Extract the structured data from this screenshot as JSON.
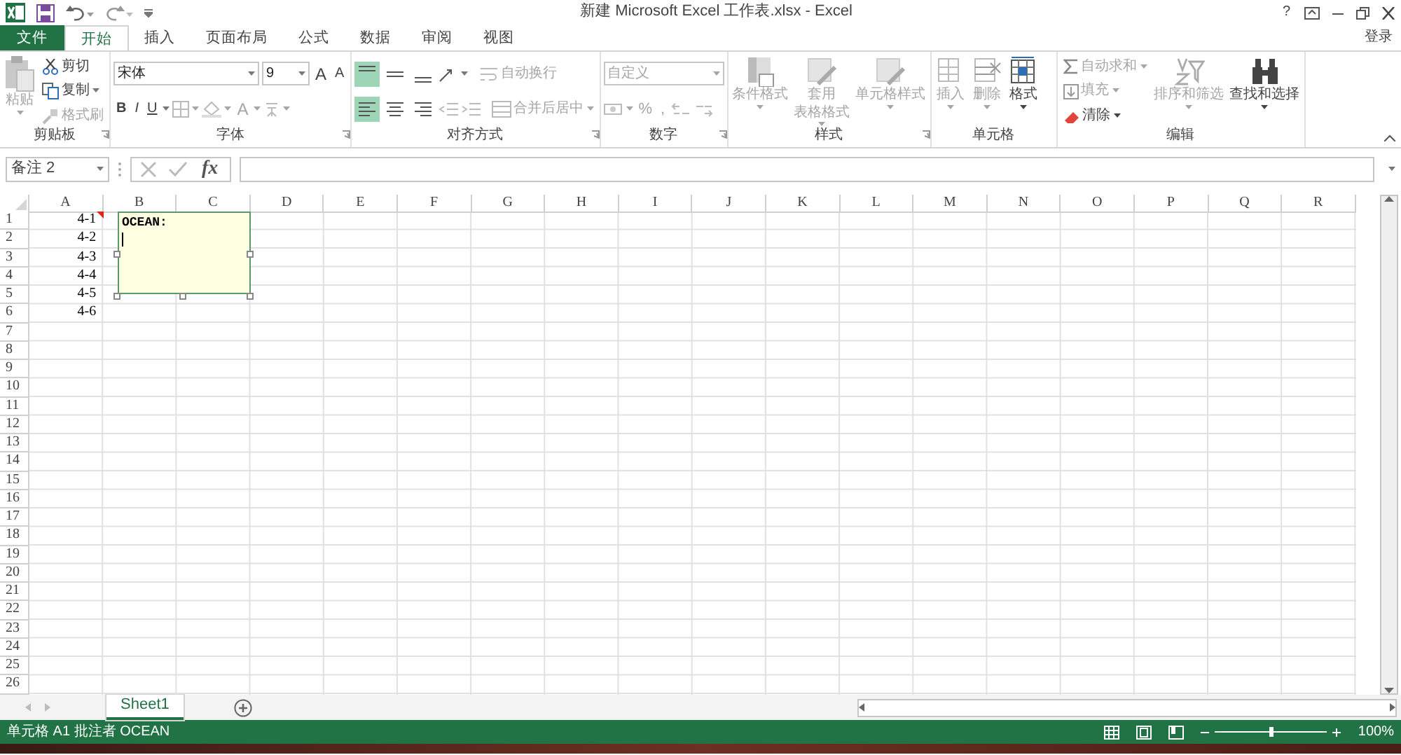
{
  "window": {
    "title": "新建 Microsoft Excel 工作表.xlsx - Excel",
    "help": "?",
    "sign_in": "登录"
  },
  "ribbon_tabs": [
    {
      "label": "文件",
      "kind": "file",
      "selected": false
    },
    {
      "label": "开始",
      "kind": "tab",
      "selected": true
    },
    {
      "label": "插入",
      "kind": "tab",
      "selected": false
    },
    {
      "label": "页面布局",
      "kind": "tab",
      "selected": false
    },
    {
      "label": "公式",
      "kind": "tab",
      "selected": false
    },
    {
      "label": "数据",
      "kind": "tab",
      "selected": false
    },
    {
      "label": "审阅",
      "kind": "tab",
      "selected": false
    },
    {
      "label": "视图",
      "kind": "tab",
      "selected": false
    }
  ],
  "clipboard": {
    "label": "剪贴板",
    "paste": "粘贴",
    "cut": "剪切",
    "copy": "复制",
    "format_painter": "格式刷"
  },
  "font": {
    "label": "字体",
    "font_name": "宋体",
    "font_size": "9",
    "grow": "A",
    "shrink": "A",
    "bold": "B",
    "italic": "I",
    "underline": "U",
    "font_color": "A"
  },
  "alignment": {
    "label": "对齐方式",
    "vertical": [
      {
        "selected": true
      },
      {
        "selected": false
      },
      {
        "selected": false
      }
    ],
    "horizontal": [
      {
        "selected": true
      },
      {
        "selected": false
      },
      {
        "selected": false
      }
    ],
    "wrap_text": "自动换行",
    "merge_center": "合并后居中"
  },
  "number": {
    "label": "数字",
    "format": "自定义",
    "percent": "%",
    "comma": ","
  },
  "styles": {
    "label": "样式",
    "buttons": [
      {
        "lines": [
          "条件格式"
        ],
        "disabled": true
      },
      {
        "lines": [
          "套用",
          "表格格式"
        ],
        "disabled": true
      },
      {
        "lines": [
          "单元格样式"
        ],
        "disabled": true
      }
    ]
  },
  "cells": {
    "label": "单元格",
    "buttons": [
      {
        "label": "插入",
        "disabled": true
      },
      {
        "label": "删除",
        "disabled": true
      },
      {
        "label": "格式",
        "disabled": false
      }
    ]
  },
  "editing": {
    "label": "编辑",
    "small": [
      {
        "label": "自动求和",
        "disabled": true
      },
      {
        "label": "填充",
        "disabled": true
      },
      {
        "label": "清除",
        "disabled": false
      }
    ],
    "sort_filter": {
      "label": "排序和筛选",
      "disabled": true
    },
    "find_select": {
      "label": "查找和选择",
      "disabled": false
    }
  },
  "formula_bar": {
    "name_box": "备注 2",
    "function_label": "fx"
  },
  "sheet": {
    "columns": [
      "A",
      "B",
      "C",
      "D",
      "E",
      "F",
      "G",
      "H",
      "I",
      "J",
      "K",
      "L",
      "M",
      "N",
      "O",
      "P",
      "Q",
      "R"
    ],
    "rows": [
      {
        "label": "1",
        "a": "4-1",
        "has_comment": true
      },
      {
        "label": "2",
        "a": "4-2",
        "has_comment": false
      },
      {
        "label": "3",
        "a": "4-3",
        "has_comment": false
      },
      {
        "label": "4",
        "a": "4-4",
        "has_comment": false
      },
      {
        "label": "5",
        "a": "4-5",
        "has_comment": false
      },
      {
        "label": "6",
        "a": "4-6",
        "has_comment": false
      },
      {
        "label": "7",
        "has_comment": false
      },
      {
        "label": "8",
        "has_comment": false
      },
      {
        "label": "9",
        "has_comment": false
      },
      {
        "label": "10",
        "has_comment": false
      },
      {
        "label": "11",
        "has_comment": false
      },
      {
        "label": "12",
        "has_comment": false
      },
      {
        "label": "13",
        "has_comment": false
      },
      {
        "label": "14",
        "has_comment": false
      },
      {
        "label": "15",
        "has_comment": false
      },
      {
        "label": "16",
        "has_comment": false
      },
      {
        "label": "17",
        "has_comment": false
      },
      {
        "label": "18",
        "has_comment": false
      },
      {
        "label": "19",
        "has_comment": false
      },
      {
        "label": "20",
        "has_comment": false
      },
      {
        "label": "21",
        "has_comment": false
      },
      {
        "label": "22",
        "has_comment": false
      },
      {
        "label": "23",
        "has_comment": false
      },
      {
        "label": "24",
        "has_comment": false
      },
      {
        "label": "25",
        "has_comment": false
      },
      {
        "label": "26",
        "has_comment": false
      }
    ]
  },
  "comment": {
    "author": "OCEAN:"
  },
  "sheet_tabs": [
    {
      "label": "Sheet1",
      "selected": true
    }
  ],
  "status_bar": {
    "text": "单元格 A1 批注者 OCEAN",
    "zoom": {
      "level": 0.5,
      "reading": "100%"
    }
  }
}
